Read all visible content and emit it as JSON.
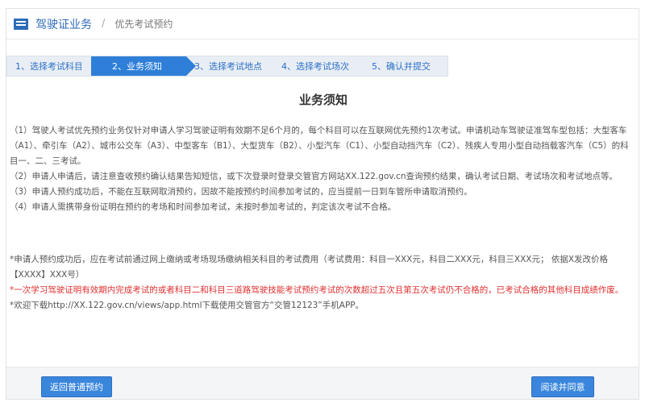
{
  "header": {
    "section": "驾驶证业务",
    "separator": "/",
    "page": "优先考试预约",
    "icon": "book-icon"
  },
  "steps": [
    {
      "label": "1、选择考试科目"
    },
    {
      "label": "2、业务须知"
    },
    {
      "label": "3、选择考试地点"
    },
    {
      "label": "4、选择考试场次"
    },
    {
      "label": "5、确认并提交"
    }
  ],
  "active_step": 2,
  "title": "业务须知",
  "notes": [
    "（1）驾驶人考试优先预约业务仅针对申请人学习驾驶证明有效期不足6个月的，每个科目可以在互联网优先预约1次考试。申请机动车驾驶证准驾车型包括：大型客车（A1）、牵引车（A2）、城市公交车（A3）、中型客车（B1）、大型货车（B2）、小型汽车（C1）、小型自动挡汽车（C2）、残疾人专用小型自动挡载客汽车（C5）的科目一、二、三考试。",
    "（2）申请人申请后，请注意查收预约确认结果告知短信，或下次登录时登录交管官方网站XX.122.gov.cn查询预约结果，确认考试日期、考试场次和考试地点等。",
    "（3）申请人预约成功后，不能在互联网取消预约，因故不能按预约时间参加考试的，应当提前一日到车管所申请取消预约。",
    "（4）申请人需携带身份证明在预约的考场和时间参加考试，未按时参加考试的，判定该次考试不合格。"
  ],
  "extra": {
    "fee_note": "*申请人预约成功后，应在考试前通过网上缴纳或考场现场缴纳相关科目的考试费用（考试费用：科目一XXX元，科目二XXX元，科目三XXX元；   依据X发改价格【XXXX】XXX号）",
    "warning": "*一次学习驾驶证明有效期内完成考试的或者科目二和科目三道路驾驶技能考试预约考试的次数超过五次且第五次考试仍不合格的，已考试合格的其他科目成绩作废。",
    "app_note": "*欢迎下载http://XX.122.gov.cn/views/app.html下载使用交管官方“交管12123”手机APP。"
  },
  "buttons": {
    "back": "返回普通预约",
    "agree": "阅读并同意"
  },
  "colors": {
    "accent": "#2f7fd8",
    "warning": "#e03030"
  }
}
